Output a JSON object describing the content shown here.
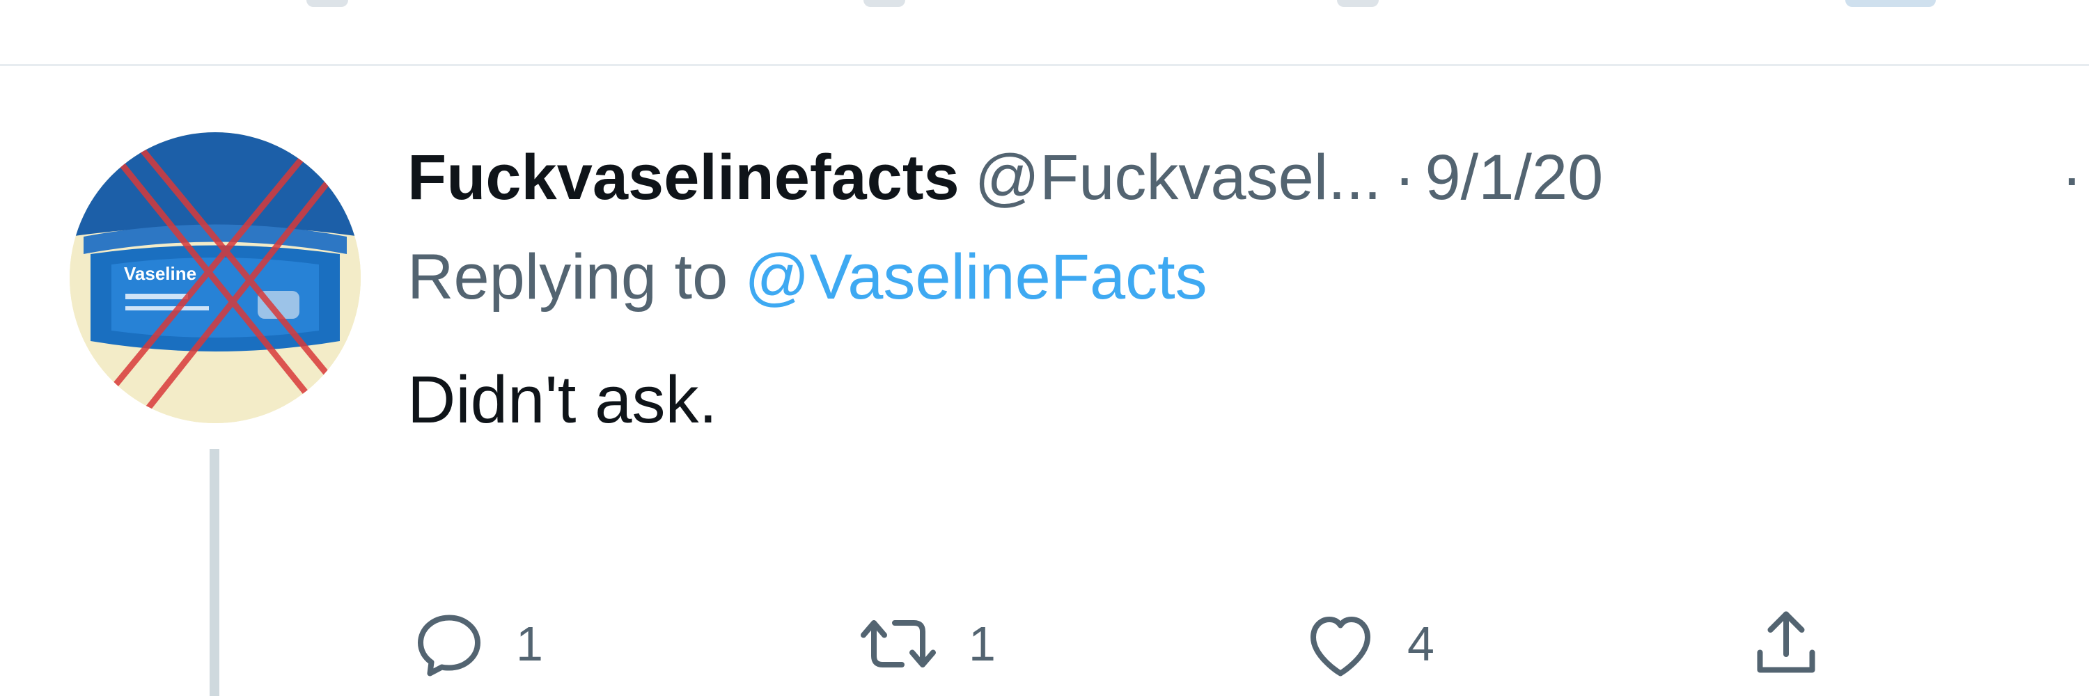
{
  "tweet": {
    "display_name": "Fuckvaselinefacts",
    "handle": "@Fuckvasel...",
    "separator": "·",
    "date": "9/1/20",
    "more_indicator": "·",
    "replying_prefix": "Replying to",
    "replying_to": "@VaselineFacts",
    "text": "Didn't ask.",
    "avatar_label": "Vaseline",
    "actions": {
      "reply": {
        "icon": "reply-icon",
        "count": "1"
      },
      "retweet": {
        "icon": "retweet-icon",
        "count": "1"
      },
      "like": {
        "icon": "heart-icon",
        "count": "4"
      },
      "share": {
        "icon": "share-icon",
        "count": ""
      }
    }
  },
  "colors": {
    "primary_text": "#0f1419",
    "secondary_text": "#536471",
    "link": "#1d9bf0",
    "divider": "#e7ecf0",
    "thread_line": "#cfd9de",
    "avatar_cross": "#d83a3a",
    "avatar_blue": "#1c5fa8"
  }
}
